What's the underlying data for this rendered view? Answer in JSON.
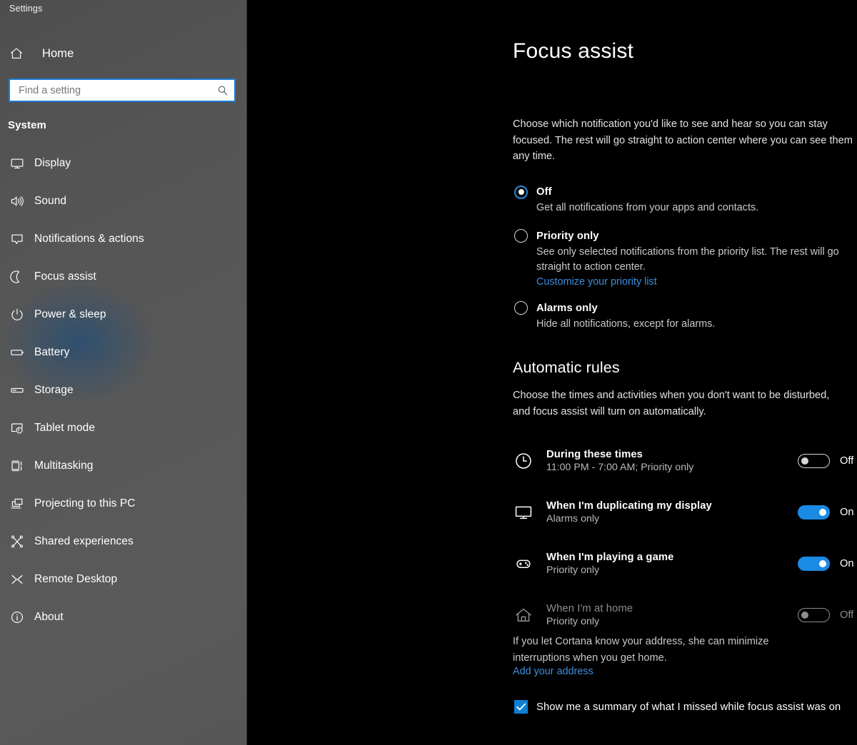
{
  "window": {
    "title": "Settings"
  },
  "sidebar": {
    "home": {
      "label": "Home",
      "icon": "home-icon"
    },
    "search": {
      "placeholder": "Find a setting",
      "value": "",
      "icon": "search-icon"
    },
    "section_header": "System",
    "items": [
      {
        "label": "Display",
        "icon": "monitor-icon"
      },
      {
        "label": "Sound",
        "icon": "speaker-icon"
      },
      {
        "label": "Notifications & actions",
        "icon": "notification-balloon-icon"
      },
      {
        "label": "Focus assist",
        "icon": "moon-icon"
      },
      {
        "label": "Power & sleep",
        "icon": "power-icon"
      },
      {
        "label": "Battery",
        "icon": "battery-icon"
      },
      {
        "label": "Storage",
        "icon": "storage-drive-icon"
      },
      {
        "label": "Tablet mode",
        "icon": "tablet-touch-icon"
      },
      {
        "label": "Multitasking",
        "icon": "multitasking-icon"
      },
      {
        "label": "Projecting to this PC",
        "icon": "projecting-icon"
      },
      {
        "label": "Shared experiences",
        "icon": "share-nodes-icon"
      },
      {
        "label": "Remote Desktop",
        "icon": "remote-desktop-icon"
      },
      {
        "label": "About",
        "icon": "info-icon"
      }
    ]
  },
  "main": {
    "page_title": "Focus assist",
    "intro": "Choose which notification you'd like to see and hear so you can stay focused. The rest will go straight to action center where you can see them any time.",
    "mode_options": [
      {
        "label": "Off",
        "description": "Get all notifications from your apps and contacts.",
        "selected": true,
        "link": null
      },
      {
        "label": "Priority only",
        "description": "See only selected notifications from the priority list. The rest will go straight to action center.",
        "selected": false,
        "link": "Customize your priority list"
      },
      {
        "label": "Alarms only",
        "description": "Hide all notifications, except for alarms.",
        "selected": false,
        "link": null
      }
    ],
    "automatic_rules": {
      "heading": "Automatic rules",
      "description": "Choose the times and activities when you don't want to be disturbed, and focus assist will turn on automatically.",
      "rules": [
        {
          "title": "During these times",
          "subtitle": "11:00 PM - 7:00 AM; Priority only",
          "state": "Off",
          "on": false,
          "disabled": false,
          "icon": "clock-icon"
        },
        {
          "title": "When I'm duplicating my display",
          "subtitle": "Alarms only",
          "state": "On",
          "on": true,
          "disabled": false,
          "icon": "monitor-icon"
        },
        {
          "title": "When I'm playing a game",
          "subtitle": "Priority only",
          "state": "On",
          "on": true,
          "disabled": false,
          "icon": "gamepad-icon"
        },
        {
          "title": "When I'm at home",
          "subtitle": "Priority only",
          "state": "Off",
          "on": false,
          "disabled": true,
          "icon": "house-icon"
        }
      ],
      "cortana_note": "If you let Cortana know your address, she can minimize interruptions when you get home.",
      "cortana_link": "Add your address"
    },
    "summary_checkbox": {
      "label": "Show me a summary of what I missed while focus assist was on",
      "checked": true
    }
  },
  "colors": {
    "accent_blue": "#0078d7",
    "toggle_on": "#1a8ae5",
    "link_blue": "#3d8edb",
    "checkbox_blue": "#0f7fd4",
    "main_background": "#000000",
    "sidebar_background": "#585858",
    "search_border": "#1c7dd4"
  }
}
